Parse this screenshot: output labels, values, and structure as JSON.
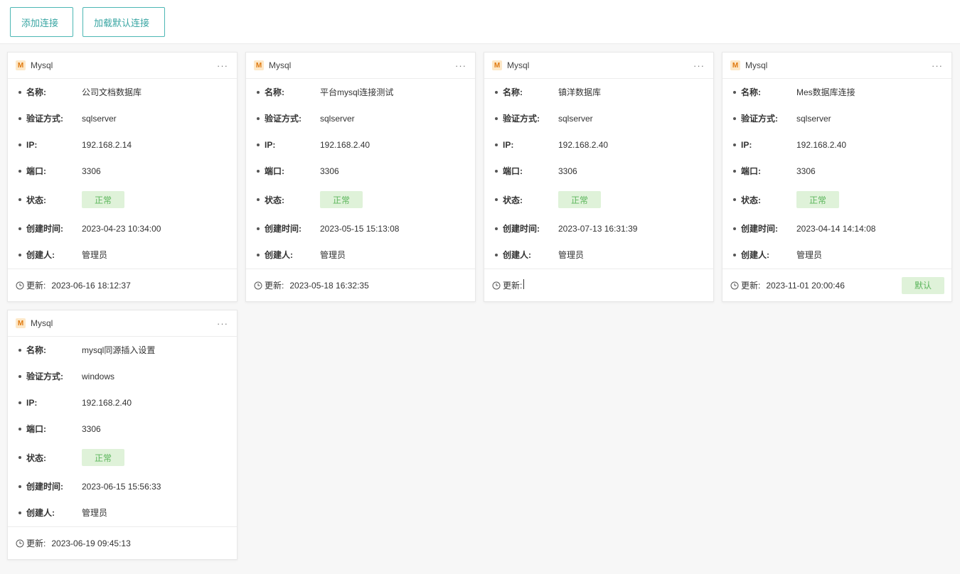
{
  "toolbar": {
    "add_label": "添加连接",
    "load_default_label": "加载默认连接"
  },
  "labels": {
    "name": "名称:",
    "auth": "验证方式:",
    "ip": "IP:",
    "port": "端口:",
    "status": "状态:",
    "created_time": "创建时间:",
    "creator": "创建人:",
    "updated": "更新:"
  },
  "cards": [
    {
      "type": "Mysql",
      "name": "公司文档数据库",
      "auth": "sqlserver",
      "ip": "192.168.2.14",
      "port": "3306",
      "status": "正常",
      "created_time": "2023-04-23 10:34:00",
      "creator": "管理员",
      "updated": "2023-06-16 18:12:37",
      "default_label": ""
    },
    {
      "type": "Mysql",
      "name": "平台mysql连接测试",
      "auth": "sqlserver",
      "ip": "192.168.2.40",
      "port": "3306",
      "status": "正常",
      "created_time": "2023-05-15 15:13:08",
      "creator": "管理员",
      "updated": "2023-05-18 16:32:35",
      "default_label": ""
    },
    {
      "type": "Mysql",
      "name": "镇洋数据库",
      "auth": "sqlserver",
      "ip": "192.168.2.40",
      "port": "3306",
      "status": "正常",
      "created_time": "2023-07-13 16:31:39",
      "creator": "管理员",
      "updated": "",
      "default_label": ""
    },
    {
      "type": "Mysql",
      "name": "Mes数据库连接",
      "auth": "sqlserver",
      "ip": "192.168.2.40",
      "port": "3306",
      "status": "正常",
      "created_time": "2023-04-14 14:14:08",
      "creator": "管理员",
      "updated": "2023-11-01 20:00:46",
      "default_label": "默认"
    },
    {
      "type": "Mysql",
      "name": "mysql同源插入设置",
      "auth": "windows",
      "ip": "192.168.2.40",
      "port": "3306",
      "status": "正常",
      "created_time": "2023-06-15 15:56:33",
      "creator": "管理员",
      "updated": "2023-06-19 09:45:13",
      "default_label": ""
    }
  ],
  "icons": {
    "db_icon_letter": "M",
    "more_icon": "···"
  },
  "colors": {
    "accent": "#4db7b4",
    "status_bg": "#dff2d9",
    "status_text": "#5bb55b",
    "db_icon_bg": "#fde8c8",
    "db_icon_text": "#e07a10"
  }
}
